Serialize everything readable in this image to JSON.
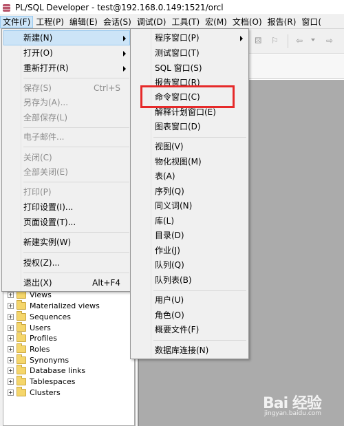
{
  "window": {
    "title": "PL/SQL Developer - test@192.168.0.149:1521/orcl"
  },
  "menubar": [
    "文件(F)",
    "工程(P)",
    "编辑(E)",
    "会话(S)",
    "调试(D)",
    "工具(T)",
    "宏(M)",
    "文档(O)",
    "报告(R)",
    "窗口("
  ],
  "file_menu": {
    "items": [
      {
        "label": "新建(N)",
        "shortcut": "",
        "submenu": true,
        "state": "hover"
      },
      {
        "label": "打开(O)",
        "shortcut": "",
        "submenu": true,
        "state": "enabled"
      },
      {
        "label": "重新打开(R)",
        "shortcut": "",
        "submenu": true,
        "state": "enabled"
      },
      {
        "label": "保存(S)",
        "shortcut": "Ctrl+S",
        "submenu": false,
        "state": "disabled"
      },
      {
        "label": "另存为(A)...",
        "shortcut": "",
        "submenu": false,
        "state": "disabled"
      },
      {
        "label": "全部保存(L)",
        "shortcut": "",
        "submenu": false,
        "state": "disabled"
      },
      {
        "label": "电子邮件...",
        "shortcut": "",
        "submenu": false,
        "state": "disabled"
      },
      {
        "label": "关闭(C)",
        "shortcut": "",
        "submenu": false,
        "state": "disabled"
      },
      {
        "label": "全部关闭(E)",
        "shortcut": "",
        "submenu": false,
        "state": "disabled"
      },
      {
        "label": "打印(P)",
        "shortcut": "",
        "submenu": false,
        "state": "disabled"
      },
      {
        "label": "打印设置(I)...",
        "shortcut": "",
        "submenu": false,
        "state": "enabled"
      },
      {
        "label": "页面设置(T)...",
        "shortcut": "",
        "submenu": false,
        "state": "enabled"
      },
      {
        "label": "新建实例(W)",
        "shortcut": "",
        "submenu": false,
        "state": "enabled"
      },
      {
        "label": "授权(Z)...",
        "shortcut": "",
        "submenu": false,
        "state": "enabled"
      },
      {
        "label": "退出(X)",
        "shortcut": "Alt+F4",
        "submenu": false,
        "state": "enabled"
      }
    ]
  },
  "new_menu": {
    "items": [
      {
        "label": "程序窗口(P)",
        "submenu": true
      },
      {
        "label": "测试窗口(T)",
        "submenu": false
      },
      {
        "label": "SQL 窗口(S)",
        "submenu": false
      },
      {
        "label": "报告窗口(R)",
        "submenu": false
      },
      {
        "label": "命令窗口(C)",
        "submenu": false,
        "highlighted": true
      },
      {
        "label": "解释计划窗口(E)",
        "submenu": false
      },
      {
        "label": "图表窗口(D)",
        "submenu": false
      },
      {
        "label": "视图(V)",
        "submenu": false
      },
      {
        "label": "物化视图(M)",
        "submenu": false
      },
      {
        "label": "表(A)",
        "submenu": false
      },
      {
        "label": "序列(Q)",
        "submenu": false
      },
      {
        "label": "同义词(N)",
        "submenu": false
      },
      {
        "label": "库(L)",
        "submenu": false
      },
      {
        "label": "目录(D)",
        "submenu": false
      },
      {
        "label": "作业(J)",
        "submenu": false
      },
      {
        "label": "队列(Q)",
        "submenu": false
      },
      {
        "label": "队列表(B)",
        "submenu": false
      },
      {
        "label": "用户(U)",
        "submenu": false
      },
      {
        "label": "角色(O)",
        "submenu": false
      },
      {
        "label": "概要文件(F)",
        "submenu": false
      },
      {
        "label": "数据库连接(N)",
        "submenu": false
      }
    ]
  },
  "tree": {
    "items": [
      "Views",
      "Materialized views",
      "Sequences",
      "Users",
      "Profiles",
      "Roles",
      "Synonyms",
      "Database links",
      "Tablespaces",
      "Clusters"
    ]
  },
  "watermark": {
    "text": "Bai 经验",
    "sub": "jingyan.baidu.com"
  },
  "colors": {
    "highlight_box": "#e62a2a",
    "menu_hover": "#cce4f7",
    "disabled_text": "#8d8d8d"
  }
}
